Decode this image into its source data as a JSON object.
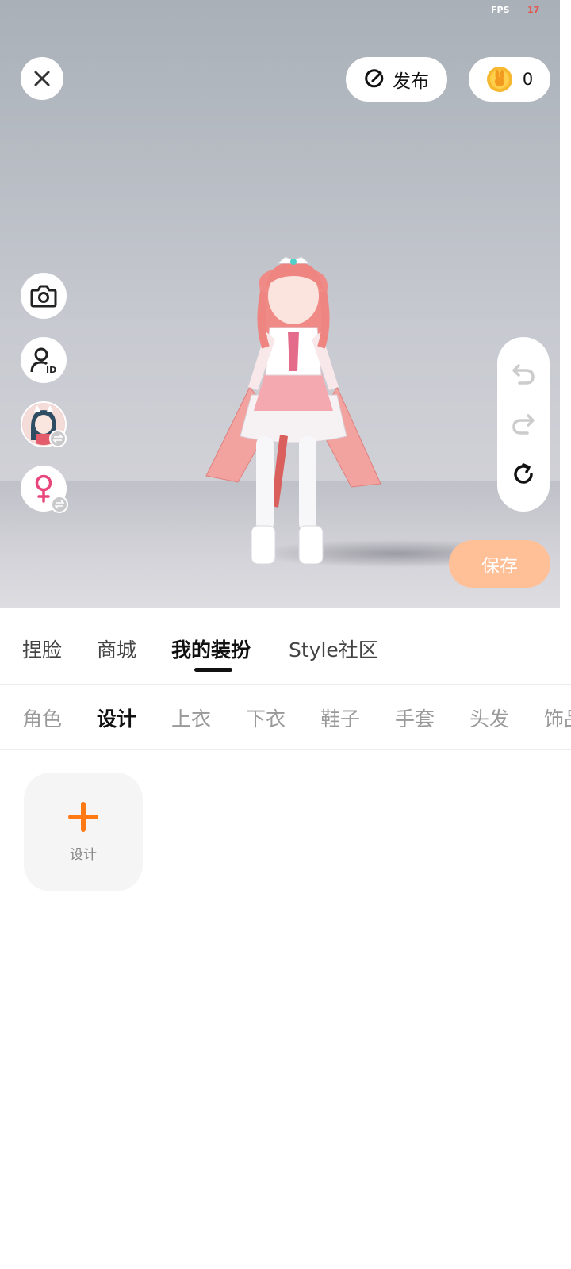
{
  "status": {
    "fps_label": "FPS",
    "fps_value": "17"
  },
  "toolbar": {
    "close_icon": "close-icon",
    "publish_label": "发布",
    "publish_icon": "publish-check-icon",
    "coin_icon": "bunny-coin-icon",
    "coin_count": "0"
  },
  "side_tools": [
    {
      "name": "camera",
      "icon": "camera-icon"
    },
    {
      "name": "id-card",
      "icon": "user-id-icon"
    },
    {
      "name": "switch-avatar",
      "icon": "avatar-thumbnail"
    },
    {
      "name": "switch-gender",
      "icon": "female-icon"
    }
  ],
  "history": {
    "undo_icon": "undo-icon",
    "redo_icon": "redo-icon",
    "reset_icon": "refresh-icon"
  },
  "save_label": "保存",
  "main_tabs": [
    "捏脸",
    "商城",
    "我的装扮",
    "Style社区"
  ],
  "active_main_tab": "我的装扮",
  "sub_tabs": [
    "角色",
    "设计",
    "上衣",
    "下衣",
    "鞋子",
    "手套",
    "头发",
    "饰品"
  ],
  "active_sub_tab": "设计",
  "design_card": {
    "label": "设计",
    "icon": "plus-icon"
  },
  "colors": {
    "accent_orange": "#ff7a14",
    "save_button": "#ffc098",
    "fps_value": "#e2564d",
    "female_icon": "#e8457a"
  }
}
